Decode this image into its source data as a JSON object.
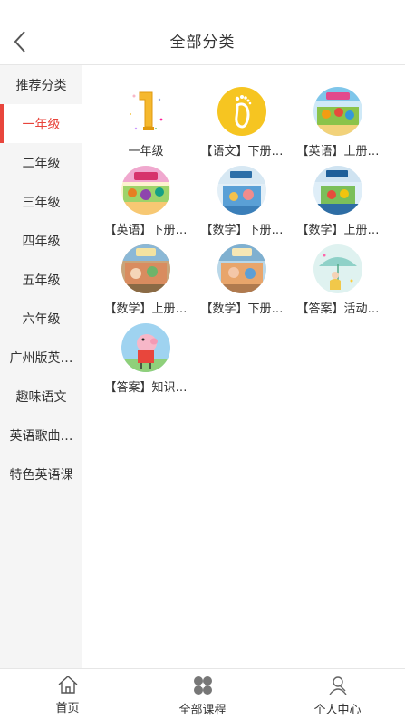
{
  "header": {
    "title": "全部分类",
    "back_icon": "chevron-left-icon"
  },
  "sidebar": {
    "active_index": 1,
    "accent": "#e8453c",
    "items": [
      {
        "label": "推荐分类"
      },
      {
        "label": "一年级"
      },
      {
        "label": "二年级"
      },
      {
        "label": "三年级"
      },
      {
        "label": "四年级"
      },
      {
        "label": "五年级"
      },
      {
        "label": "六年级"
      },
      {
        "label": "广州版英…"
      },
      {
        "label": "趣味语文"
      },
      {
        "label": "英语歌曲…"
      },
      {
        "label": "特色英语课"
      }
    ]
  },
  "courses": [
    {
      "label": "一年级",
      "cover": "number-one"
    },
    {
      "label": "【语文】下册…",
      "cover": "footprint"
    },
    {
      "label": "【英语】上册…",
      "cover": "english-book"
    },
    {
      "label": "【英语】下册…",
      "cover": "english-book"
    },
    {
      "label": "【数学】下册…",
      "cover": "math-book"
    },
    {
      "label": "【数学】上册…",
      "cover": "math-book"
    },
    {
      "label": "【数学】上册…",
      "cover": "math-book"
    },
    {
      "label": "【数学】下册…",
      "cover": "math-book"
    },
    {
      "label": "【答案】活动…",
      "cover": "umbrella-girl"
    },
    {
      "label": "【答案】知识…",
      "cover": "pig-cartoon"
    }
  ],
  "tabbar": [
    {
      "label": "首页",
      "icon": "home-icon"
    },
    {
      "label": "全部课程",
      "icon": "grid-icon"
    },
    {
      "label": "个人中心",
      "icon": "user-icon"
    }
  ]
}
